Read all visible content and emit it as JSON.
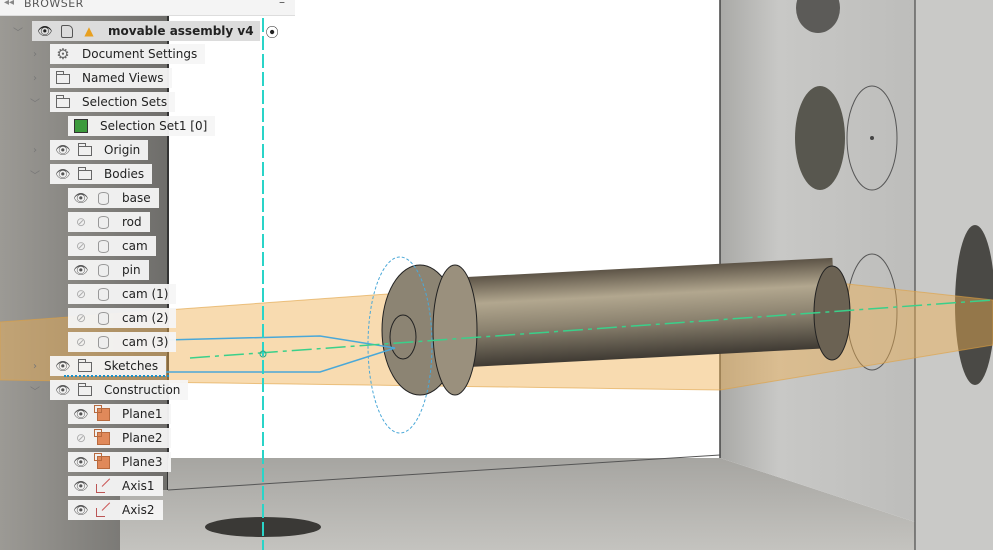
{
  "browser": {
    "title": "BROWSER",
    "collapse_icon": "double-chevron-left",
    "minimize_label": "–",
    "root": {
      "label": "movable assembly v4",
      "warning": true
    },
    "items": [
      {
        "label": "Document Settings",
        "level": 1,
        "chevron": "collapsed",
        "icon": "gear-icon",
        "eye": null
      },
      {
        "label": "Named Views",
        "level": 1,
        "chevron": "collapsed",
        "icon": "folder-icon",
        "eye": null
      },
      {
        "label": "Selection Sets",
        "level": 1,
        "chevron": "expanded",
        "icon": "folder-icon",
        "eye": null
      },
      {
        "label": "Selection Set1 [0]",
        "level": 2,
        "chevron": null,
        "icon": "selection-set-icon",
        "eye": null
      },
      {
        "label": "Origin",
        "level": 1,
        "chevron": "collapsed",
        "icon": "folder-icon",
        "eye": "visible"
      },
      {
        "label": "Bodies",
        "level": 1,
        "chevron": "expanded",
        "icon": "folder-icon",
        "eye": "visible"
      },
      {
        "label": "base",
        "level": 2,
        "chevron": null,
        "icon": "body-icon",
        "eye": "visible"
      },
      {
        "label": "rod",
        "level": 2,
        "chevron": null,
        "icon": "body-icon",
        "eye": "hidden"
      },
      {
        "label": "cam",
        "level": 2,
        "chevron": null,
        "icon": "body-icon",
        "eye": "hidden"
      },
      {
        "label": "pin",
        "level": 2,
        "chevron": null,
        "icon": "body-icon",
        "eye": "visible"
      },
      {
        "label": "cam (1)",
        "level": 2,
        "chevron": null,
        "icon": "body-icon",
        "eye": "hidden"
      },
      {
        "label": "cam (2)",
        "level": 2,
        "chevron": null,
        "icon": "body-icon",
        "eye": "hidden"
      },
      {
        "label": "cam (3)",
        "level": 2,
        "chevron": null,
        "icon": "body-icon",
        "eye": "hidden"
      },
      {
        "label": "Sketches",
        "level": 1,
        "chevron": "collapsed",
        "icon": "folder-icon",
        "eye": "visible"
      },
      {
        "label": "Construction",
        "level": 1,
        "chevron": "expanded",
        "icon": "folder-icon",
        "eye": "visible"
      },
      {
        "label": "Plane1",
        "level": 2,
        "chevron": null,
        "icon": "plane-icon",
        "eye": "visible"
      },
      {
        "label": "Plane2",
        "level": 2,
        "chevron": null,
        "icon": "plane-icon",
        "eye": "hidden"
      },
      {
        "label": "Plane3",
        "level": 2,
        "chevron": null,
        "icon": "plane-icon",
        "eye": "visible"
      },
      {
        "label": "Axis1",
        "level": 2,
        "chevron": null,
        "icon": "axis-icon",
        "eye": "visible"
      },
      {
        "label": "Axis2",
        "level": 2,
        "chevron": null,
        "icon": "axis-icon",
        "eye": "visible"
      }
    ]
  },
  "colors": {
    "axis": "#2ad4c8",
    "plane": "#f0b050",
    "sketch": "#4aa8d8"
  }
}
